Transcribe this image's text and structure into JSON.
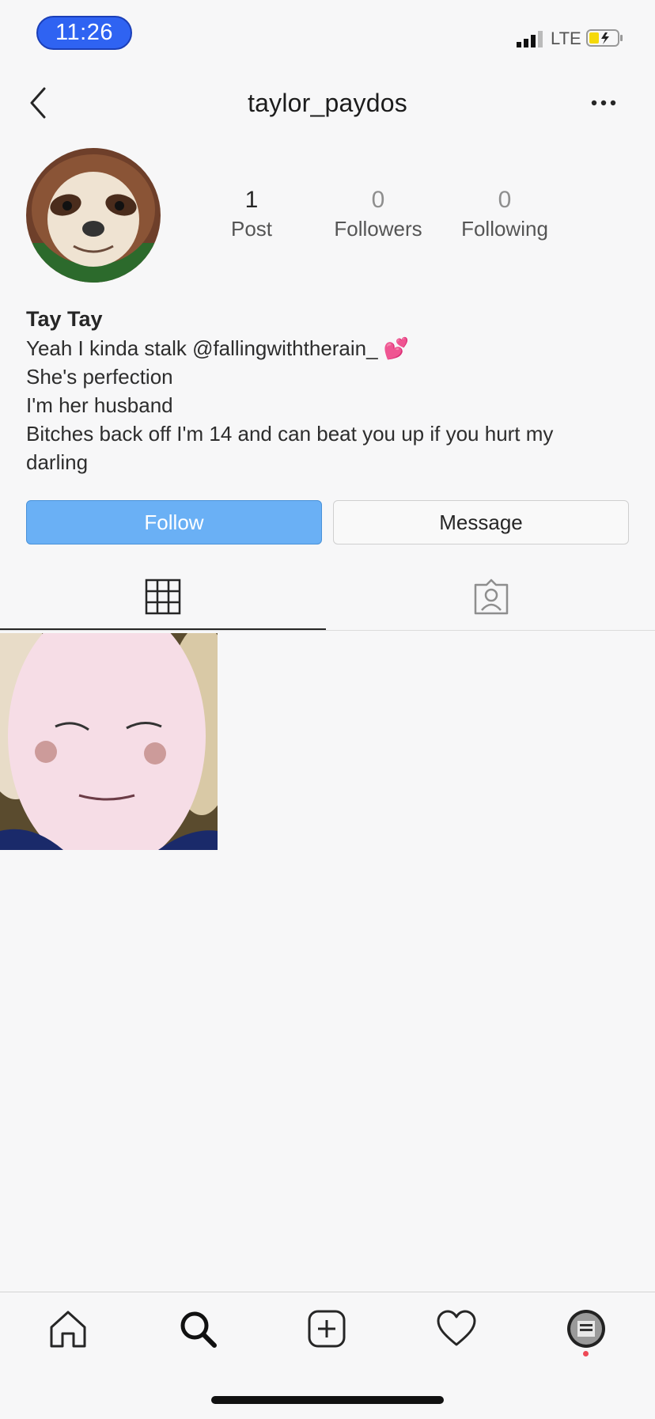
{
  "status_bar": {
    "time": "11:26",
    "network": "LTE"
  },
  "header": {
    "username": "taylor_paydos"
  },
  "profile": {
    "stats": [
      {
        "value": "1",
        "label": "Post"
      },
      {
        "value": "0",
        "label": "Followers"
      },
      {
        "value": "0",
        "label": "Following"
      }
    ],
    "display_name": "Tay Tay",
    "bio_lines": [
      "Yeah I kinda stalk @fallingwiththerain_",
      "She's perfection",
      "I'm her husband",
      "Bitches back off I'm 14 and can beat you up if you hurt my",
      "darling"
    ],
    "bio_emoji": "💕"
  },
  "actions": {
    "follow_label": "Follow",
    "message_label": "Message"
  },
  "tabs": [
    {
      "icon": "grid-icon",
      "active": true
    },
    {
      "icon": "tagged-icon",
      "active": false
    }
  ],
  "nav": {
    "icons": [
      "home-icon",
      "search-icon",
      "add-post-icon",
      "heart-icon",
      "profile-avatar"
    ]
  },
  "colors": {
    "follow_button": "#6ab0f5",
    "time_pill": "#2f63f2",
    "notification_dot": "#ed4956"
  }
}
